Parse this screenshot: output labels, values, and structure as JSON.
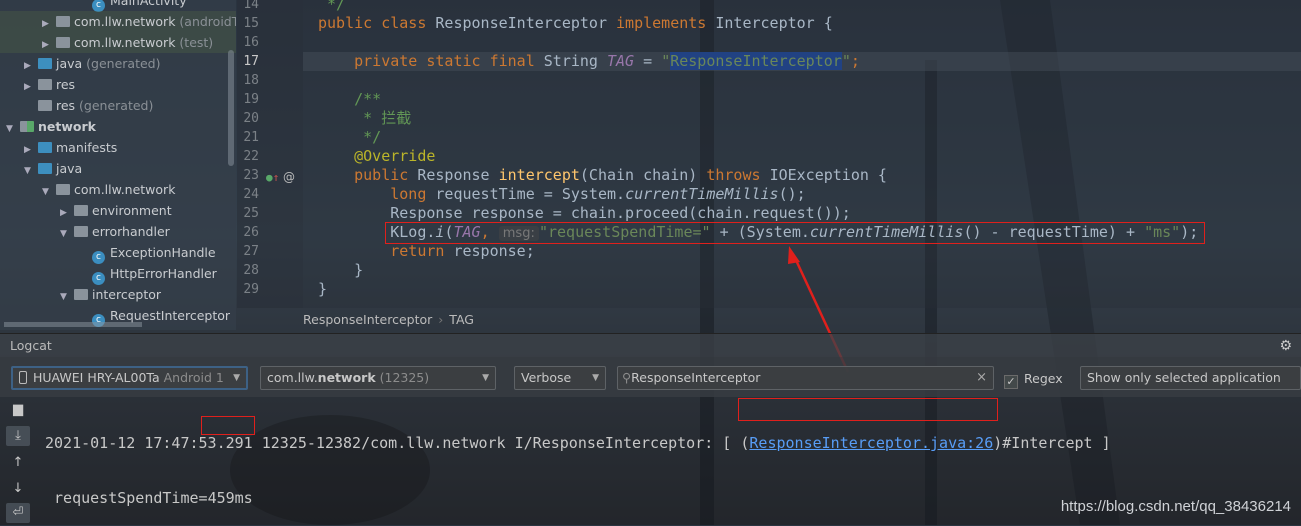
{
  "project_tree": {
    "items": [
      {
        "label": "MainActivity",
        "dim": "",
        "level": 4,
        "icon": "class",
        "arrow": ""
      },
      {
        "label": "com.llw.network",
        "dim": " (androidTest)",
        "level": 2,
        "icon": "package",
        "arrow": "right",
        "selected": true
      },
      {
        "label": "com.llw.network",
        "dim": " (test)",
        "level": 2,
        "icon": "package",
        "arrow": "right",
        "selected": true
      },
      {
        "label": "java",
        "dim": " (generated)",
        "level": 1,
        "icon": "folder",
        "arrow": "right"
      },
      {
        "label": "res",
        "dim": "",
        "level": 1,
        "icon": "res",
        "arrow": "right"
      },
      {
        "label": "res",
        "dim": " (generated)",
        "level": 1,
        "icon": "res",
        "arrow": ""
      },
      {
        "label": "network",
        "dim": "",
        "level": 0,
        "icon": "module",
        "arrow": "down",
        "bold": true
      },
      {
        "label": "manifests",
        "dim": "",
        "level": 1,
        "icon": "folder",
        "arrow": "right"
      },
      {
        "label": "java",
        "dim": "",
        "level": 1,
        "icon": "folder",
        "arrow": "down"
      },
      {
        "label": "com.llw.network",
        "dim": "",
        "level": 2,
        "icon": "package",
        "arrow": "down"
      },
      {
        "label": "environment",
        "dim": "",
        "level": 3,
        "icon": "package",
        "arrow": "right"
      },
      {
        "label": "errorhandler",
        "dim": "",
        "level": 3,
        "icon": "package",
        "arrow": "down"
      },
      {
        "label": "ExceptionHandle",
        "dim": "",
        "level": 4,
        "icon": "class",
        "arrow": ""
      },
      {
        "label": "HttpErrorHandler",
        "dim": "",
        "level": 4,
        "icon": "class",
        "arrow": ""
      },
      {
        "label": "interceptor",
        "dim": "",
        "level": 3,
        "icon": "package",
        "arrow": "down"
      },
      {
        "label": "RequestInterceptor",
        "dim": "",
        "level": 4,
        "icon": "class",
        "arrow": ""
      }
    ]
  },
  "editor": {
    "current_line": 17,
    "lines": [
      {
        "n": 14,
        "t": [
          [
            " */",
            "cmt"
          ]
        ]
      },
      {
        "n": 15,
        "t": [
          [
            "public class ",
            "kw"
          ],
          [
            "ResponseInterceptor ",
            ""
          ],
          [
            "implements ",
            "kw"
          ],
          [
            "Interceptor {",
            ""
          ]
        ]
      },
      {
        "n": 16,
        "t": []
      },
      {
        "n": 17,
        "t": [
          [
            "    private static final ",
            "kw"
          ],
          [
            "String ",
            ""
          ],
          [
            "TAG",
            "fld"
          ],
          [
            " = ",
            ""
          ],
          [
            "\"",
            "str"
          ],
          [
            "ResponseInterceptor",
            "str sel"
          ],
          [
            "\"",
            "str"
          ],
          [
            ";",
            "kw"
          ]
        ]
      },
      {
        "n": 18,
        "t": []
      },
      {
        "n": 19,
        "t": [
          [
            "    /**",
            "cmt"
          ]
        ]
      },
      {
        "n": 20,
        "t": [
          [
            "     * 拦截",
            "cmt"
          ]
        ]
      },
      {
        "n": 21,
        "t": [
          [
            "     */",
            "cmt"
          ]
        ]
      },
      {
        "n": 22,
        "t": [
          [
            "    @Override",
            "ann"
          ]
        ]
      },
      {
        "n": 23,
        "t": [
          [
            "    public ",
            "kw"
          ],
          [
            "Response ",
            ""
          ],
          [
            "intercept",
            "fn"
          ],
          [
            "(Chain chain) ",
            ""
          ],
          [
            "throws ",
            "kw"
          ],
          [
            "IOException {",
            ""
          ]
        ]
      },
      {
        "n": 24,
        "t": [
          [
            "        long ",
            "kw"
          ],
          [
            "requestTime = System.",
            ""
          ],
          [
            "currentTimeMillis",
            "itl"
          ],
          [
            "();",
            ""
          ]
        ]
      },
      {
        "n": 25,
        "t": [
          [
            "        Response response = chain.proceed(chain.request());",
            ""
          ]
        ]
      },
      {
        "n": 26,
        "t": [
          [
            "        KLog.",
            ""
          ],
          [
            "i",
            "itl"
          ],
          [
            "(",
            ""
          ],
          [
            "TAG",
            "fld"
          ],
          [
            ", ",
            "kw"
          ],
          [
            " msg: ",
            "hint"
          ],
          [
            "\"requestSpendTime=\"",
            "str"
          ],
          [
            " + (System.",
            ""
          ],
          [
            "currentTimeMillis",
            "itl"
          ],
          [
            "() - requestTime) + ",
            ""
          ],
          [
            "\"ms\"",
            "str"
          ],
          [
            ");",
            ""
          ]
        ]
      },
      {
        "n": 27,
        "t": [
          [
            "        return ",
            "kw"
          ],
          [
            "response;",
            ""
          ]
        ]
      },
      {
        "n": 28,
        "t": [
          [
            "    }",
            ""
          ]
        ]
      },
      {
        "n": 29,
        "t": [
          [
            "}",
            ""
          ]
        ]
      }
    ]
  },
  "breadcrumb": {
    "class": "ResponseInterceptor",
    "field": "TAG"
  },
  "logcat": {
    "title": "Logcat",
    "device": "HUAWEI HRY-AL00Ta",
    "device_dim": " Android 1",
    "process_pre": "com.llw.",
    "process_bold": "network",
    "process_pid": " (12325)",
    "level": "Verbose",
    "search": "ResponseInterceptor",
    "regex_label": "Regex",
    "regex_checked": true,
    "filter": "Show only selected application",
    "log": {
      "prefix": "2021-01-12 17:47:53.291 12325-12382/com.llw.network I/ResponseInterceptor: [ (",
      "link": "ResponseInterceptor.java:26",
      "suffix": ")#Intercept ]",
      "line2_pre": " requestSpendTime=",
      "line2_val": "459ms"
    }
  },
  "watermark": "https://blog.csdn.net/qq_38436214",
  "colors": {
    "annotation_red": "#e0201c",
    "keyword": "#cc7832",
    "string": "#6a8759",
    "link": "#589df6"
  }
}
